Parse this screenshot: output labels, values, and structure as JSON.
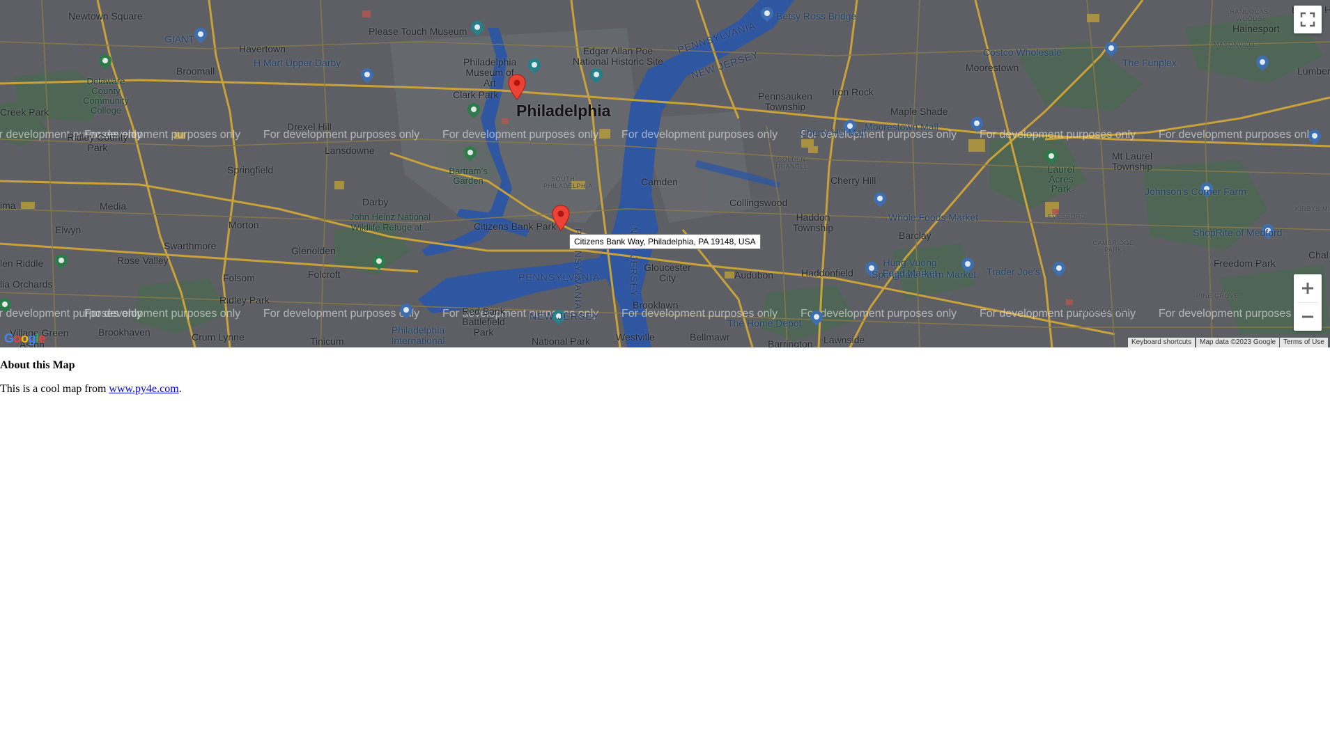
{
  "map": {
    "city_label": "Philadelphia",
    "place_labels": [
      "Newtown Square",
      "Havertown",
      "Broomall",
      "Delaware County Community College",
      "Drexel Hill",
      "Lansdowne",
      "Springfield",
      "Media",
      "Elwyn",
      "Swarthmore",
      "Morton",
      "Darby",
      "Glenolden",
      "Folcroft",
      "Folsom",
      "Ridley Park",
      "Rose Valley",
      "Brookhaven",
      "Crum Lynne",
      "Tinicum",
      "National Park",
      "Westville",
      "Bellmawr",
      "Barrington",
      "Lawnside",
      "Brooklawn",
      "Gloucester City",
      "Audubon",
      "Haddonfield",
      "Haddon Township",
      "Collingswood",
      "Camden",
      "Pennsauken Township",
      "Iron Rock",
      "Moorestown",
      "Maple Shade",
      "Cherry Hill",
      "Barclay",
      "Mt Laurel Township",
      "Hainesport",
      "Freedom Park",
      "Clark Park",
      "Citizens Bank Park",
      "Bartram's Garden",
      "John Heinz National Wildlife Refuge at...",
      "Edgar Allan Poe National Historic Site",
      "Philadelphia Museum of Art",
      "Please Touch Museum",
      "Betsy Ross Bridge",
      "Costco Wholesale",
      "The Funplex",
      "Moorestown Mall",
      "Cherry Hill Mall",
      "Whole Foods Market",
      "Springdale Farm Market",
      "Hung Vuong Food Market",
      "Trader Joe's",
      "ShopRite of Medford",
      "Johnson's Corner Farm",
      "Laurel Acres Park",
      "H Mart Upper Darby",
      "GIANT",
      "Philadelphia International",
      "Red Bank Battlefield Park",
      "The Home Depot",
      "Lumberto",
      "Lowe's Home",
      "SOUTH PHILADELPHIA",
      "GOLDEN TRIANGLE",
      "CAMBRIDGE PARK",
      "EVESBORO",
      "PINE GROVE",
      "EVANS CORNER",
      "KIRBYS MILL",
      "MASONVILLE",
      "RANCOCAS WOODS",
      "Creek Park",
      "Ridley County Park",
      "Chal",
      "ima",
      "len Riddle",
      "lia Orchards",
      "Village Green",
      "Aston"
    ],
    "state_labels": [
      "PENNSYLVANIA",
      "NEW JERSEY",
      "PENNSYLVANIA",
      "NEW JERSEY",
      "PENNSYLVANIA",
      "NEW JERSEY"
    ],
    "watermark": "For development purposes only",
    "marker_tooltip": "Citizens Bank Way, Philadelphia, PA 19148, USA",
    "markers": [
      {
        "name": "Philadelphia Museum of Art area",
        "color": "#ea4335"
      },
      {
        "name": "Citizens Bank Park",
        "color": "#ea4335"
      }
    ],
    "controls": {
      "fullscreen_icon": "fullscreen-icon",
      "zoom_in_icon": "plus-icon",
      "zoom_out_icon": "minus-icon"
    },
    "attribution": {
      "keyboard_shortcuts": "Keyboard shortcuts",
      "map_data": "Map data ©2023 Google",
      "terms": "Terms of Use"
    },
    "logo": "Google",
    "colors": {
      "land": "#5d5f64",
      "water": "#2f56a0",
      "park": "#4f6a55",
      "road": "#c9a23a",
      "marker": "#ea4335"
    }
  },
  "content": {
    "heading": "About this Map",
    "para_prefix": "This is a cool map from ",
    "link_text": "www.py4e.com",
    "para_suffix": "."
  }
}
